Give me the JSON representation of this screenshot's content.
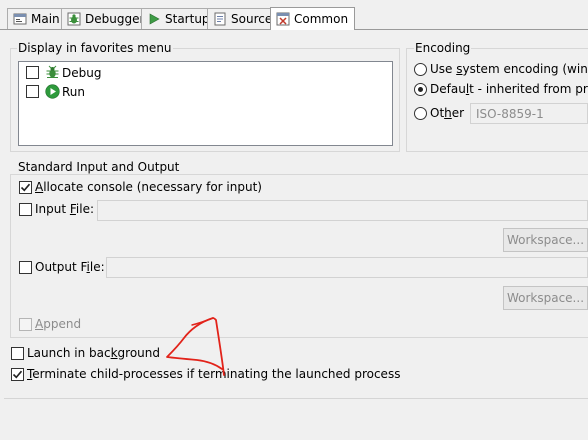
{
  "tabs": [
    {
      "label": "Main",
      "icon": "main-icon"
    },
    {
      "label": "Debugger",
      "icon": "debugger-icon"
    },
    {
      "label": "Startup",
      "icon": "startup-icon"
    },
    {
      "label": "Source",
      "icon": "source-icon"
    },
    {
      "label": "Common",
      "icon": "common-icon",
      "active": true
    }
  ],
  "favorites": {
    "title": "Display in favorites menu",
    "items": [
      {
        "label": "Debug",
        "icon": "debug-bug-icon",
        "checked": false
      },
      {
        "label": "Run",
        "icon": "run-play-icon",
        "checked": false
      }
    ]
  },
  "encoding": {
    "title": "Encoding",
    "options": [
      {
        "label_pre": "Use ",
        "label_u": "s",
        "label_post": "ystem encoding (window",
        "selected": false
      },
      {
        "label_pre": "Defau",
        "label_u": "l",
        "label_post": "t - inherited from projec",
        "selected": true
      },
      {
        "label_pre": "Ot",
        "label_u": "h",
        "label_post": "er",
        "selected": false
      }
    ],
    "other_value": "ISO-8859-1"
  },
  "std_io": {
    "title": "Standard Input and Output",
    "allocate": {
      "label_pre": "",
      "label_u": "A",
      "label_post": "llocate console (necessary for input)",
      "checked": true
    },
    "input_file": {
      "label_pre": "Input ",
      "label_u": "F",
      "label_post": "ile:",
      "checked": false,
      "value": "",
      "workspace_btn": "Workspace..."
    },
    "output_file": {
      "label_pre": "Output F",
      "label_u": "i",
      "label_post": "le:",
      "checked": false,
      "value": "",
      "workspace_btn": "Workspace..."
    },
    "append": {
      "label_pre": "",
      "label_u": "A",
      "label_post": "ppend",
      "checked": false,
      "disabled": true
    }
  },
  "launch_bg": {
    "label_pre": "Launch in bac",
    "label_u": "k",
    "label_post": "ground",
    "checked": false
  },
  "terminate": {
    "label_pre": "",
    "label_u": "T",
    "label_post": "erminate child-processes if terminating the launched process",
    "checked": true
  },
  "colors": {
    "annotation": "#e2231a",
    "run_green": "#2e9a3c",
    "bug_green": "#3b8f3b"
  }
}
